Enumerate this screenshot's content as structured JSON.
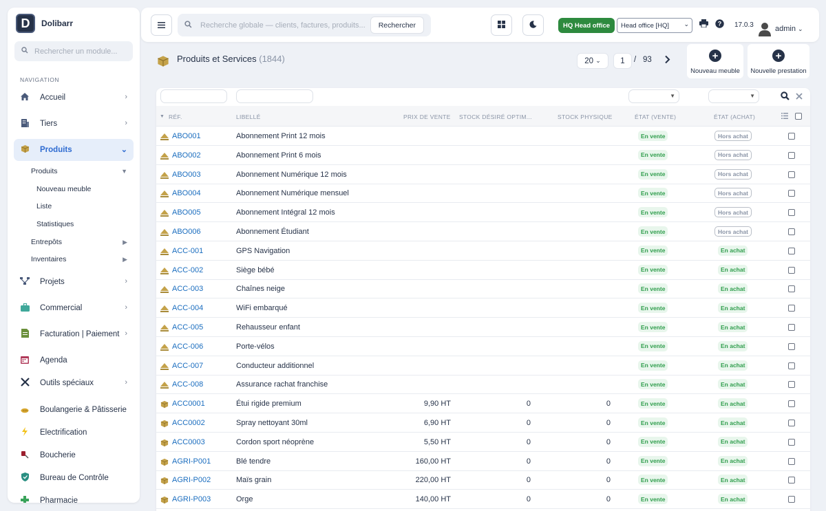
{
  "app": {
    "name": "Dolibarr",
    "logo_letter": "D"
  },
  "sidebar": {
    "search_placeholder": "Rechercher un module...",
    "nav_title": "NAVIGATION",
    "items": [
      {
        "label": "Accueil",
        "icon": "home-icon"
      },
      {
        "label": "Tiers",
        "icon": "building-icon"
      },
      {
        "label": "Produits",
        "icon": "box-icon"
      },
      {
        "label": "Projets",
        "icon": "project-icon"
      },
      {
        "label": "Commercial",
        "icon": "briefcase-icon"
      },
      {
        "label": "Facturation | Paiement",
        "icon": "invoice-icon"
      },
      {
        "label": "Agenda",
        "icon": "calendar-icon"
      },
      {
        "label": "Outils spéciaux",
        "icon": "tools-icon"
      },
      {
        "label": "Boulangerie & Pâtisserie",
        "icon": "bread-icon"
      },
      {
        "label": "Electrification",
        "icon": "bolt-icon"
      },
      {
        "label": "Boucherie",
        "icon": "meat-icon"
      },
      {
        "label": "Bureau de Contrôle",
        "icon": "shield-icon"
      },
      {
        "label": "Pharmacie",
        "icon": "cross-icon"
      }
    ],
    "sub_items": [
      "Produits",
      "Nouveau meuble",
      "Liste",
      "Statistiques",
      "Entrepôts",
      "Inventaires"
    ]
  },
  "topbar": {
    "search_placeholder": "Recherche globale — clients, factures, produits...",
    "search_button": "Rechercher",
    "hq_badge": "HQ Head office",
    "entity_select": "Head office [HQ]",
    "version": "17.0.3",
    "user": "admin"
  },
  "page": {
    "title": "Produits et Services",
    "count": "(1844)",
    "per_page": "20",
    "current_page": "1",
    "page_sep": "/",
    "total_pages": "93",
    "btn_new_furniture": "Nouveau meuble",
    "btn_new_service": "Nouvelle prestation"
  },
  "table": {
    "headers": {
      "ref": "RÉF.",
      "label": "LIBELLÉ",
      "price": "PRIX DE VENTE",
      "stock_desired": "STOCK DÉSIRÉ OPTIM...",
      "stock_physical": "STOCK PHYSIQUE",
      "status_sell": "ÉTAT (VENTE)",
      "status_buy": "ÉTAT (ACHAT)"
    },
    "rows": [
      {
        "ref": "ABO001",
        "label": "Abonnement Print 12 mois",
        "type": "service",
        "price": "",
        "stock_desired": "",
        "stock": "",
        "sell": "En vente",
        "buy": "Hors achat"
      },
      {
        "ref": "ABO002",
        "label": "Abonnement Print 6 mois",
        "type": "service",
        "price": "",
        "stock_desired": "",
        "stock": "",
        "sell": "En vente",
        "buy": "Hors achat"
      },
      {
        "ref": "ABO003",
        "label": "Abonnement Numérique 12 mois",
        "type": "service",
        "price": "",
        "stock_desired": "",
        "stock": "",
        "sell": "En vente",
        "buy": "Hors achat"
      },
      {
        "ref": "ABO004",
        "label": "Abonnement Numérique mensuel",
        "type": "service",
        "price": "",
        "stock_desired": "",
        "stock": "",
        "sell": "En vente",
        "buy": "Hors achat"
      },
      {
        "ref": "ABO005",
        "label": "Abonnement Intégral 12 mois",
        "type": "service",
        "price": "",
        "stock_desired": "",
        "stock": "",
        "sell": "En vente",
        "buy": "Hors achat"
      },
      {
        "ref": "ABO006",
        "label": "Abonnement Étudiant",
        "type": "service",
        "price": "",
        "stock_desired": "",
        "stock": "",
        "sell": "En vente",
        "buy": "Hors achat"
      },
      {
        "ref": "ACC-001",
        "label": "GPS Navigation",
        "type": "service",
        "price": "",
        "stock_desired": "",
        "stock": "",
        "sell": "En vente",
        "buy": "En achat"
      },
      {
        "ref": "ACC-002",
        "label": "Siège bébé",
        "type": "service",
        "price": "",
        "stock_desired": "",
        "stock": "",
        "sell": "En vente",
        "buy": "En achat"
      },
      {
        "ref": "ACC-003",
        "label": "Chaînes neige",
        "type": "service",
        "price": "",
        "stock_desired": "",
        "stock": "",
        "sell": "En vente",
        "buy": "En achat"
      },
      {
        "ref": "ACC-004",
        "label": "WiFi embarqué",
        "type": "service",
        "price": "",
        "stock_desired": "",
        "stock": "",
        "sell": "En vente",
        "buy": "En achat"
      },
      {
        "ref": "ACC-005",
        "label": "Rehausseur enfant",
        "type": "service",
        "price": "",
        "stock_desired": "",
        "stock": "",
        "sell": "En vente",
        "buy": "En achat"
      },
      {
        "ref": "ACC-006",
        "label": "Porte-vélos",
        "type": "service",
        "price": "",
        "stock_desired": "",
        "stock": "",
        "sell": "En vente",
        "buy": "En achat"
      },
      {
        "ref": "ACC-007",
        "label": "Conducteur additionnel",
        "type": "service",
        "price": "",
        "stock_desired": "",
        "stock": "",
        "sell": "En vente",
        "buy": "En achat"
      },
      {
        "ref": "ACC-008",
        "label": "Assurance rachat franchise",
        "type": "service",
        "price": "",
        "stock_desired": "",
        "stock": "",
        "sell": "En vente",
        "buy": "En achat"
      },
      {
        "ref": "ACC0001",
        "label": "Étui rigide premium",
        "type": "product",
        "price": "9,90 HT",
        "stock_desired": "0",
        "stock": "0",
        "sell": "En vente",
        "buy": "En achat"
      },
      {
        "ref": "ACC0002",
        "label": "Spray nettoyant 30ml",
        "type": "product",
        "price": "6,90 HT",
        "stock_desired": "0",
        "stock": "0",
        "sell": "En vente",
        "buy": "En achat"
      },
      {
        "ref": "ACC0003",
        "label": "Cordon sport néoprène",
        "type": "product",
        "price": "5,50 HT",
        "stock_desired": "0",
        "stock": "0",
        "sell": "En vente",
        "buy": "En achat"
      },
      {
        "ref": "AGRI-P001",
        "label": "Blé tendre",
        "type": "product",
        "price": "160,00 HT",
        "stock_desired": "0",
        "stock": "0",
        "sell": "En vente",
        "buy": "En achat"
      },
      {
        "ref": "AGRI-P002",
        "label": "Maïs grain",
        "type": "product",
        "price": "220,00 HT",
        "stock_desired": "0",
        "stock": "0",
        "sell": "En vente",
        "buy": "En achat"
      },
      {
        "ref": "AGRI-P003",
        "label": "Orge",
        "type": "product",
        "price": "140,00 HT",
        "stock_desired": "0",
        "stock": "0",
        "sell": "En vente",
        "buy": "En achat"
      }
    ]
  },
  "colors": {
    "accent": "#2e6bd1",
    "link": "#1a6dbf",
    "success": "#2d8a3e",
    "sidebar_active_bg": "#e6eefa"
  }
}
